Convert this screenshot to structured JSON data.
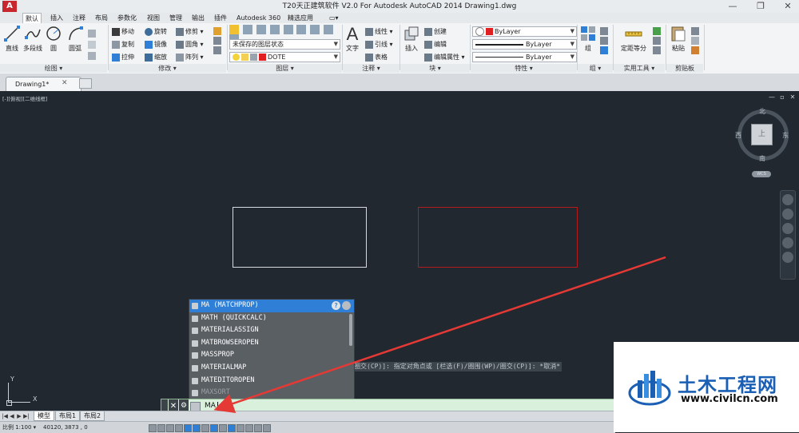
{
  "window": {
    "title": "T20天正建筑软件 V2.0 For Autodesk AutoCAD 2014    Drawing1.dwg",
    "logo_letter": "A",
    "controls": [
      "—",
      "❐",
      "✕"
    ]
  },
  "menu": {
    "tabs": [
      "默认",
      "插入",
      "注释",
      "布局",
      "参数化",
      "视图",
      "管理",
      "输出",
      "插件",
      "Autodesk 360",
      "精选应用",
      "▭▾"
    ]
  },
  "ribbon": {
    "draw": {
      "title": "绘图 ▾",
      "line": "直线",
      "polyline": "多段线",
      "circle": "圆",
      "arc": "圆弧"
    },
    "modify": {
      "title": "修改 ▾",
      "move": "移动",
      "rotate": "旋转",
      "trim": "修剪 ▾",
      "copy": "复制",
      "mirror": "镜像",
      "fillet": "圆角 ▾",
      "stretch": "拉伸",
      "scale": "缩放",
      "array": "阵列 ▾"
    },
    "layers": {
      "title": "图层 ▾",
      "state": "未保存的图层状态",
      "current_layer": "DOTE",
      "layer_color": "#e02020"
    },
    "annotation": {
      "title": "注释 ▾",
      "text": "文字",
      "linear": "线性 ▾",
      "leader": "引线 ▾",
      "table": "表格"
    },
    "block": {
      "title": "块 ▾",
      "insert": "插入",
      "create": "创建",
      "edit": "编辑",
      "edit_attr": "编辑属性 ▾"
    },
    "properties": {
      "title": "特性 ▾",
      "color": "ByLayer",
      "linetype": "ByLayer",
      "lineweight": "ByLayer",
      "color_swatch": "#e02020"
    },
    "groups": {
      "title": "组 ▾",
      "group": "组"
    },
    "utilities": {
      "title": "实用工具 ▾",
      "measure": "定距等分"
    },
    "clipboard": {
      "title": "剪贴板",
      "paste": "粘贴"
    }
  },
  "document": {
    "tab_label": "Drawing1*",
    "close_glyph": "✕"
  },
  "viewport": {
    "label": "[-][俯视][二维线框]",
    "controls": [
      "—",
      "▫",
      "✕"
    ],
    "compass": {
      "north": "北",
      "south": "南",
      "east": "东",
      "west": "西",
      "top": "上"
    },
    "wcs": "WCS"
  },
  "ucs": {
    "x": "X",
    "y": "Y"
  },
  "command": {
    "history": "圈交(CP)]: 指定对角点或 [栏选(F)/圈围(WP)/圈交(CP)]: *取消*",
    "input_value": "MA",
    "close_glyph": "✕",
    "wrench_glyph": "🔧"
  },
  "autocomplete": {
    "items": [
      {
        "label": "MA (MATCHPROP)",
        "state": "selected"
      },
      {
        "label": "MATH (QUICKCALC)",
        "state": "normal"
      },
      {
        "label": "MATERIALASSIGN",
        "state": "normal"
      },
      {
        "label": "MATBROWSEROPEN",
        "state": "normal"
      },
      {
        "label": "MASSPROP",
        "state": "normal"
      },
      {
        "label": "MATERIALMAP",
        "state": "normal"
      },
      {
        "label": "MATEDITOROPEN",
        "state": "normal"
      },
      {
        "label": "MAXSORT",
        "state": "dimmed"
      }
    ],
    "help": "?"
  },
  "layout_tabs": {
    "arrows": [
      "|◀",
      "◀",
      "▶",
      "▶|"
    ],
    "tabs": [
      "模型",
      "布局1",
      "布局2"
    ]
  },
  "status": {
    "scale": "比例 1:100 ▾",
    "coords": "40120, 3873 , 0"
  },
  "watermark": {
    "title": "土木工程网",
    "url": "www.civilcn.com"
  },
  "colors": {
    "canvas_bg": "#212830",
    "accent_red": "#e53935",
    "selection_blue": "#2f7fd6"
  }
}
